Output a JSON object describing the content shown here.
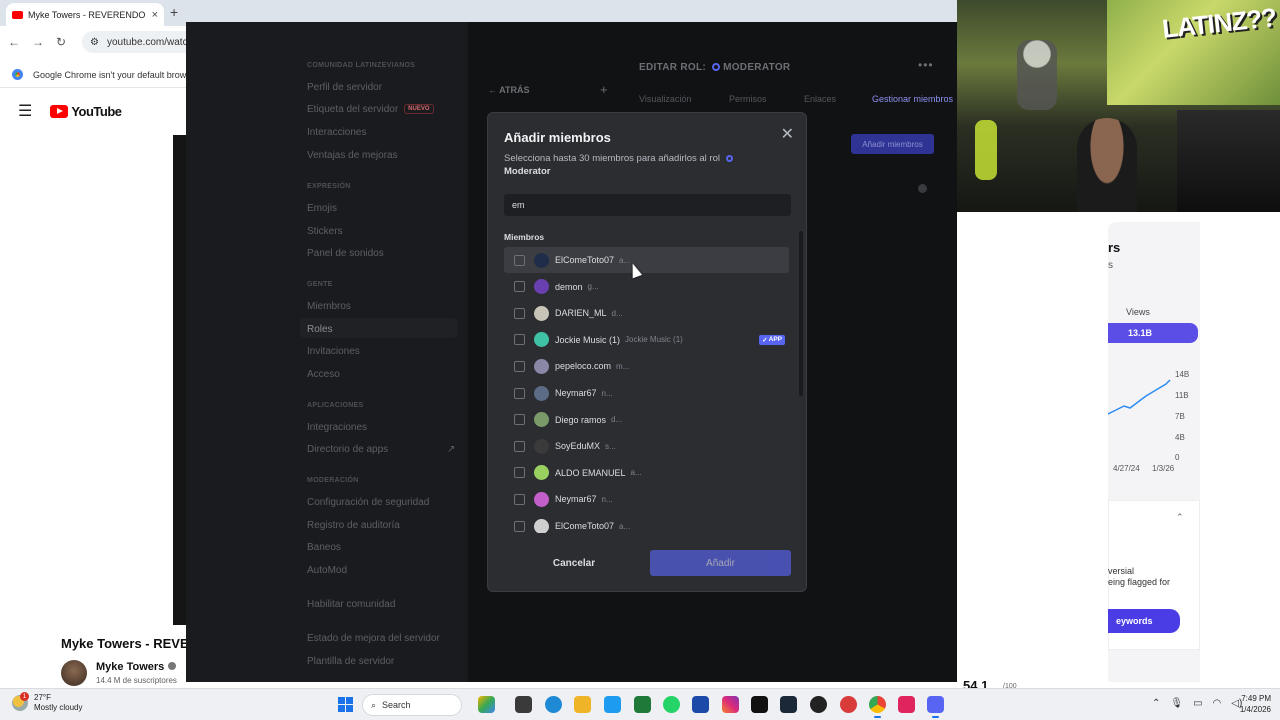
{
  "browser": {
    "tab_title": "Myke Towers - REVERENDO (Vi",
    "url": "youtube.com/watch",
    "infobar_text": "Google Chrome isn't your default brow",
    "new_tab_symbol": "+"
  },
  "youtube": {
    "logo_text": "YouTube",
    "video_title": "Myke Towers - REVEF",
    "channel_name": "Myke Towers",
    "subscribers": "14.4 M de suscriptores"
  },
  "stats_panel": {
    "heading": "rs",
    "subheading": "s",
    "views_label": "Views",
    "views_value": "13.1B",
    "y_ticks": [
      "14B",
      "11B",
      "7B",
      "4B",
      "0"
    ],
    "x_ticks": [
      "4/27/24",
      "1/3/26"
    ],
    "adv_line1": "versial",
    "adv_line2": "eing flagged for",
    "keywords_button": "eywords",
    "big_number": "54.1",
    "big_number_sub": "/100"
  },
  "webcam": {
    "graffiti_text": "LATINZ??"
  },
  "discord": {
    "sidebar": {
      "sections": [
        {
          "title": "COMUNIDAD LATINZEVIANOS",
          "items": [
            "Perfil de servidor",
            "Etiqueta del servidor",
            "Interacciones",
            "Ventajas de mejoras"
          ]
        },
        {
          "title": "EXPRESIÓN",
          "items": [
            "Emojis",
            "Stickers",
            "Panel de sonidos"
          ]
        },
        {
          "title": "GENTE",
          "items": [
            "Miembros",
            "Roles",
            "Invitaciones",
            "Acceso"
          ]
        },
        {
          "title": "APLICACIONES",
          "items": [
            "Integraciones",
            "Directorio de apps"
          ]
        },
        {
          "title": "MODERACIÓN",
          "items": [
            "Configuración de seguridad",
            "Registro de auditoría",
            "Baneos",
            "AutoMod"
          ]
        },
        {
          "title": "",
          "items": [
            "Habilitar comunidad"
          ]
        },
        {
          "title": "",
          "items": [
            "Estado de mejora del servidor",
            "Plantilla de servidor"
          ]
        }
      ],
      "new_badge": "NUEVO",
      "active_item": "Roles"
    },
    "header": {
      "back": "ATRÁS",
      "edit_role_prefix": "EDITAR ROL:",
      "role_name": "MODERATOR",
      "tabs": [
        "Visualización",
        "Permisos",
        "Enlaces",
        "Gestionar miembros"
      ],
      "add_members_button": "Añadir miembros"
    },
    "modal": {
      "title": "Añadir miembros",
      "description_prefix": "Selecciona hasta 30 miembros para añadirlos al rol",
      "description_role": "Moderator",
      "search_value": "em",
      "members_label": "Miembros",
      "members": [
        {
          "name": "ElComeToto07",
          "handle": "a...",
          "avatar": "#1f2d4a",
          "app": false
        },
        {
          "name": "demon",
          "handle": "g...",
          "avatar": "#6a3fb0",
          "app": false
        },
        {
          "name": "DARIEN_ML",
          "handle": "d...",
          "avatar": "#c9c4b8",
          "app": false
        },
        {
          "name": "Jockie Music (1)",
          "handle": "Jockie Music (1)",
          "avatar": "#3fc1a6",
          "app": true
        },
        {
          "name": "pepeloco.com",
          "handle": "m...",
          "avatar": "#8a86a6",
          "app": false
        },
        {
          "name": "Neymar67",
          "handle": "n...",
          "avatar": "#5c6b86",
          "app": false
        },
        {
          "name": "Diego ramos",
          "handle": "d...",
          "avatar": "#7a9a6a",
          "app": false
        },
        {
          "name": "SoyEduMX",
          "handle": "s...",
          "avatar": "#3a3a3a",
          "app": false
        },
        {
          "name": "ALDO EMANUEL",
          "handle": "a...",
          "avatar": "#9ad060",
          "app": false
        },
        {
          "name": "Neymar67",
          "handle": "n...",
          "avatar": "#c25fc9",
          "app": false
        },
        {
          "name": "ElComeToto07",
          "handle": "a...",
          "avatar": "#cfcfcf",
          "app": false
        }
      ],
      "app_tag": "APP",
      "cancel": "Cancelar",
      "add": "Añadir"
    }
  },
  "taskbar": {
    "temperature": "27°F",
    "weather": "Mostly cloudy",
    "notification_count": "1",
    "search_label": "Search",
    "time": "7:49 PM",
    "date": "1/4/2026"
  },
  "colors": {
    "discord_blurple": "#5865f2",
    "modal_bg": "#2b2d31",
    "youtube_red": "#ff0000",
    "views_pill": "#5b4ee6"
  }
}
